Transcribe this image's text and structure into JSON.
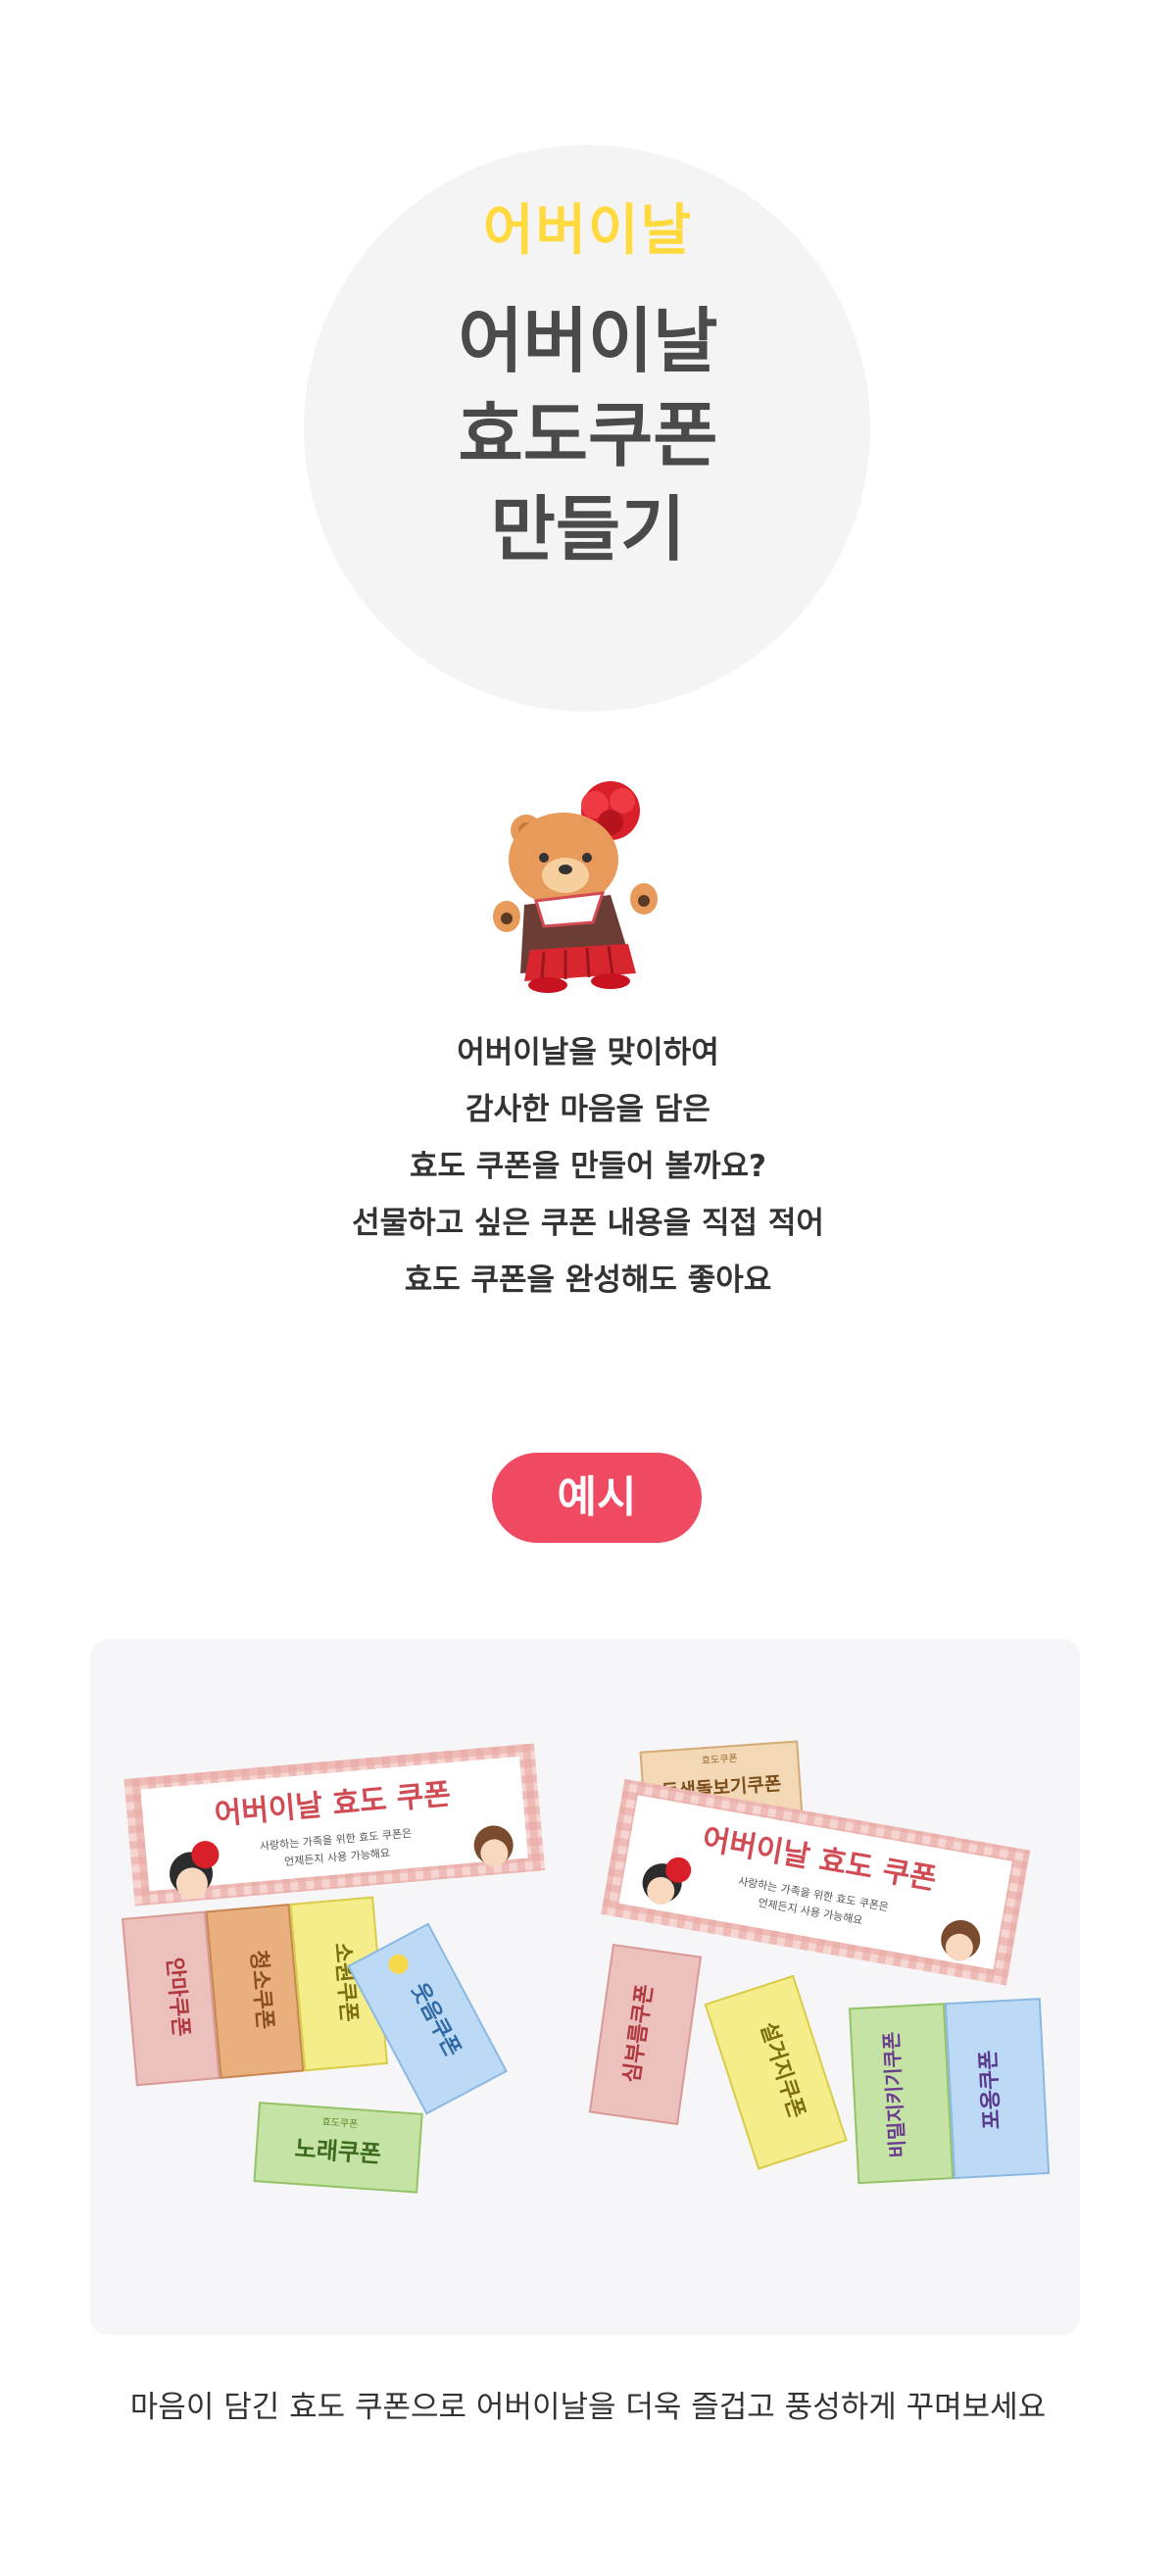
{
  "hero": {
    "label": "어버이날",
    "title_lines": [
      "어버이날",
      "효도쿠폰",
      "만들기"
    ],
    "label_color": "#ffd93d",
    "circle_color": "#f4f4f4"
  },
  "mascot": {
    "icon": "bear-with-carnation-icon"
  },
  "intro_lines": [
    "어버이날을 맞이하여",
    "감사한 마음을 담은",
    "효도 쿠폰을 만들어 볼까요?",
    "선물하고 싶은 쿠폰 내용을 직접 적어",
    "효도 쿠폰을 완성해도 좋아요"
  ],
  "example_badge": {
    "label": "예시",
    "color": "#f04a62"
  },
  "photo": {
    "left_header": {
      "title": "어버이날 효도 쿠폰",
      "line1": "사랑하는 가족을 위한 효도 쿠폰은",
      "line2": "언제든지 사용 가능해요"
    },
    "right_header": {
      "title": "어버이날 효도 쿠폰",
      "line1": "사랑하는 가족을 위한 효도 쿠폰은",
      "line2": "언제든지 사용 가능해요"
    },
    "left_coupons": [
      "안마쿠폰",
      "청소쿠폰",
      "소원쿠폰",
      "웃음쿠폰",
      "노래쿠폰"
    ],
    "right_coupons": [
      "동생돌보기쿠폰",
      "심부름쿠폰",
      "설거지쿠폰",
      "비밀지키기쿠폰",
      "포옹쿠폰"
    ],
    "small_label": "효도쿠폰"
  },
  "caption": "마음이 담긴 효도 쿠폰으로 어버이날을 더욱 즐겁고 풍성하게 꾸며보세요"
}
